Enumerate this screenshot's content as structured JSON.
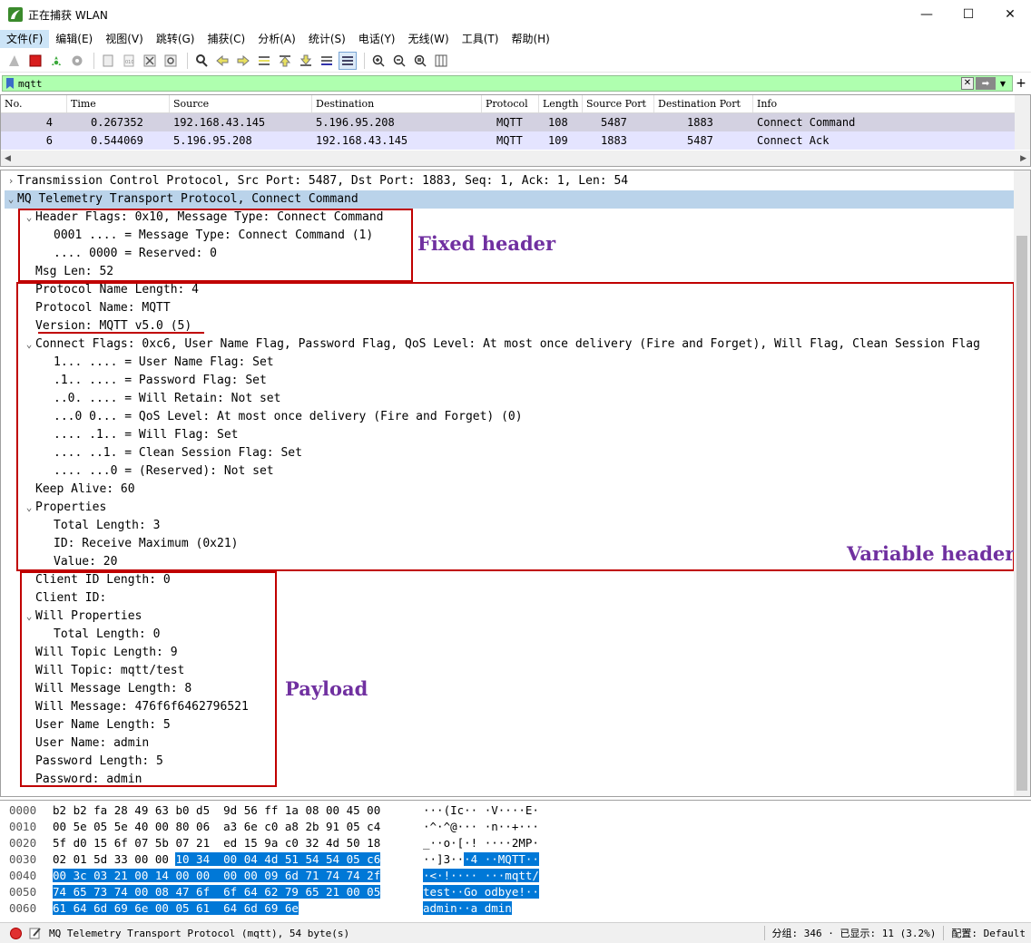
{
  "window": {
    "title": "正在捕获 WLAN",
    "minimize": "—",
    "maximize": "☐",
    "close": "✕"
  },
  "menu": [
    "文件(F)",
    "编辑(E)",
    "视图(V)",
    "跳转(G)",
    "捕获(C)",
    "分析(A)",
    "统计(S)",
    "电话(Y)",
    "无线(W)",
    "工具(T)",
    "帮助(H)"
  ],
  "toolbar": {
    "buttons": [
      "shark-fin-icon",
      "stop-icon",
      "restart-icon",
      "options-gear-icon",
      "open-file-icon",
      "save-file-icon",
      "close-file-icon",
      "reload-icon",
      "find-icon",
      "back-arrow-icon",
      "forward-arrow-icon",
      "go-to-packet-icon",
      "first-packet-icon",
      "last-packet-icon",
      "autoscroll-icon",
      "colorize-icon",
      "zoom-in-icon",
      "zoom-out-icon",
      "zoom-normal-icon",
      "resize-columns-icon"
    ]
  },
  "filter": {
    "value": "mqtt",
    "plus": "+"
  },
  "packet_list": {
    "columns": [
      "No.",
      "Time",
      "Source",
      "Destination",
      "Protocol",
      "Length",
      "Source Port",
      "Destination Port",
      "Info"
    ],
    "rows": [
      [
        "4",
        "0.267352",
        "192.168.43.145",
        "5.196.95.208",
        "MQTT",
        "108",
        "5487",
        "1883",
        "Connect Command"
      ],
      [
        "6",
        "0.544069",
        "5.196.95.208",
        "192.168.43.145",
        "MQTT",
        "109",
        "1883",
        "5487",
        "Connect Ack"
      ]
    ]
  },
  "details": [
    {
      "arrow": "›",
      "text": "Transmission Control Protocol, Src Port: 5487, Dst Port: 1883, Seq: 1, Ack: 1, Len: 54"
    },
    {
      "arrow": "⌄",
      "text": "MQ Telemetry Transport Protocol, Connect Command"
    },
    {
      "arrow": "⌄",
      "text": "Header Flags: 0x10, Message Type: Connect Command"
    },
    {
      "arrow": "",
      "text": "0001 .... = Message Type: Connect Command (1)"
    },
    {
      "arrow": "",
      "text": ".... 0000 = Reserved: 0"
    },
    {
      "arrow": "",
      "text": "Msg Len: 52"
    },
    {
      "arrow": "",
      "text": "Protocol Name Length: 4"
    },
    {
      "arrow": "",
      "text": "Protocol Name: MQTT"
    },
    {
      "arrow": "",
      "text": "Version: MQTT v5.0 (5)"
    },
    {
      "arrow": "⌄",
      "text": "Connect Flags: 0xc6, User Name Flag, Password Flag, QoS Level: At most once delivery (Fire and Forget), Will Flag, Clean Session Flag"
    },
    {
      "arrow": "",
      "text": "1... .... = User Name Flag: Set"
    },
    {
      "arrow": "",
      "text": ".1.. .... = Password Flag: Set"
    },
    {
      "arrow": "",
      "text": "..0. .... = Will Retain: Not set"
    },
    {
      "arrow": "",
      "text": "...0 0... = QoS Level: At most once delivery (Fire and Forget) (0)"
    },
    {
      "arrow": "",
      "text": ".... .1.. = Will Flag: Set"
    },
    {
      "arrow": "",
      "text": ".... ..1. = Clean Session Flag: Set"
    },
    {
      "arrow": "",
      "text": ".... ...0 = (Reserved): Not set"
    },
    {
      "arrow": "",
      "text": "Keep Alive: 60"
    },
    {
      "arrow": "⌄",
      "text": "Properties"
    },
    {
      "arrow": "",
      "text": "Total Length: 3"
    },
    {
      "arrow": "",
      "text": "ID: Receive Maximum (0x21)"
    },
    {
      "arrow": "",
      "text": "Value: 20"
    },
    {
      "arrow": "",
      "text": "Client ID Length: 0"
    },
    {
      "arrow": "",
      "text": "Client ID:"
    },
    {
      "arrow": "⌄",
      "text": "Will Properties"
    },
    {
      "arrow": "",
      "text": "Total Length: 0"
    },
    {
      "arrow": "",
      "text": "Will Topic Length: 9"
    },
    {
      "arrow": "",
      "text": "Will Topic: mqtt/test"
    },
    {
      "arrow": "",
      "text": "Will Message Length: 8"
    },
    {
      "arrow": "",
      "text": "Will Message: 476f6f6462796521"
    },
    {
      "arrow": "",
      "text": "User Name Length: 5"
    },
    {
      "arrow": "",
      "text": "User Name: admin"
    },
    {
      "arrow": "",
      "text": "Password Length: 5"
    },
    {
      "arrow": "",
      "text": "Password: admin"
    }
  ],
  "annotations": {
    "fixed_header": "Fixed header",
    "variable_header": "Variable header",
    "payload": "Payload"
  },
  "hex": [
    {
      "off": "0000",
      "bytes_a": "b2 b2 fa 28 49 63 b0 d5  9d 56 ff 1a 08 00 45 00",
      "bytes_b": "",
      "ascii_a": "···(Ic·· ·V····E·",
      "ascii_b": ""
    },
    {
      "off": "0010",
      "bytes_a": "00 5e 05 5e 40 00 80 06  a3 6e c0 a8 2b 91 05 c4",
      "bytes_b": "",
      "ascii_a": "·^·^@··· ·n··+···",
      "ascii_b": ""
    },
    {
      "off": "0020",
      "bytes_a": "5f d0 15 6f 07 5b 07 21  ed 15 9a c0 32 4d 50 18",
      "bytes_b": "",
      "ascii_a": "_··o·[·! ····2MP·",
      "ascii_b": ""
    },
    {
      "off": "0030",
      "bytes_a": "02 01 5d 33 00 00 ",
      "bytes_b": "10 34  00 04 4d 51 54 54 05 c6",
      "ascii_a": "··]3··",
      "ascii_b": "·4 ··MQTT··"
    },
    {
      "off": "0040",
      "bytes_a": "",
      "bytes_b": "00 3c 03 21 00 14 00 00  00 00 09 6d 71 74 74 2f",
      "ascii_a": "",
      "ascii_b": "·<·!···· ···mqtt/"
    },
    {
      "off": "0050",
      "bytes_a": "",
      "bytes_b": "74 65 73 74 00 08 47 6f  6f 64 62 79 65 21 00 05",
      "ascii_a": "",
      "ascii_b": "test··Go odbye!··"
    },
    {
      "off": "0060",
      "bytes_a": "",
      "bytes_b": "61 64 6d 69 6e 00 05 61  64 6d 69 6e",
      "ascii_a": "",
      "ascii_b": "admin··a dmin"
    }
  ],
  "status": {
    "left_text": "MQ Telemetry Transport Protocol (mqtt), 54 byte(s)",
    "packets": "分组: 346 · 已显示: 11 (3.2%)",
    "profile": "配置: Default"
  },
  "colors": {
    "filter_ok": "#afffaf",
    "row_selected": "#d3d1e1",
    "row_alt": "#e4e4ff",
    "tree_highlight": "#bad3ea",
    "hex_selected": "#0078d7",
    "annotation_box": "#c00000",
    "annotation_text": "#7030a0"
  }
}
